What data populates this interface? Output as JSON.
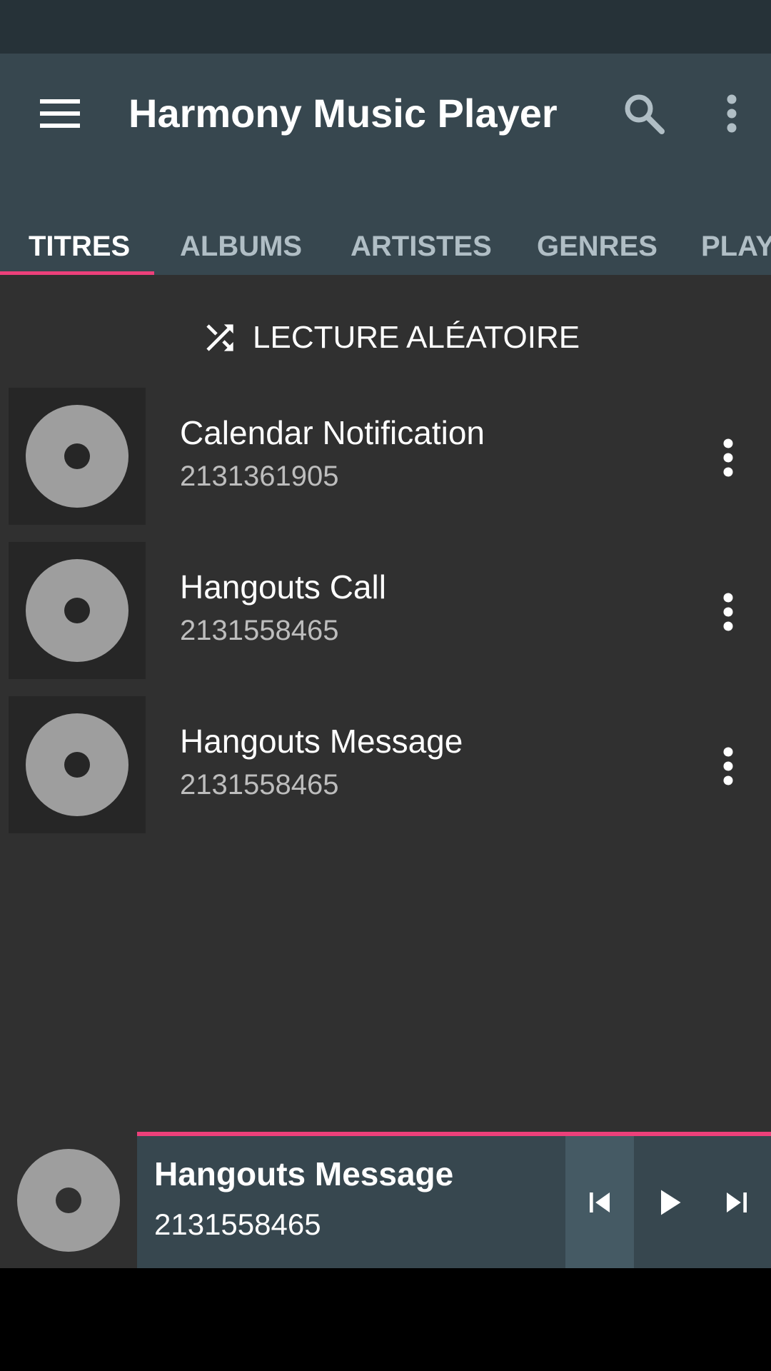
{
  "app": {
    "title": "Harmony Music Player",
    "menu_icon": "hamburger-menu-icon",
    "search_icon": "search-icon",
    "overflow_icon": "more-vert-icon"
  },
  "tabs": [
    {
      "label": "TITRES",
      "active": true
    },
    {
      "label": "ALBUMS",
      "active": false
    },
    {
      "label": "ARTISTES",
      "active": false
    },
    {
      "label": "GENRES",
      "active": false
    },
    {
      "label": "PLAY",
      "active": false
    }
  ],
  "shuffle": {
    "label": "LECTURE ALÉATOIRE",
    "icon": "shuffle-icon"
  },
  "songs": [
    {
      "title": "Calendar Notification",
      "subtitle": "2131361905"
    },
    {
      "title": "Hangouts Call",
      "subtitle": "2131558465"
    },
    {
      "title": "Hangouts Message",
      "subtitle": "2131558465"
    }
  ],
  "mini_player": {
    "title": "Hangouts Message",
    "subtitle": "2131558465",
    "progress": 1.0
  },
  "colors": {
    "accent": "#ec407a",
    "primary": "#37474f",
    "status_bar": "#263238",
    "background": "#303030",
    "disc": "#9e9e9e"
  }
}
